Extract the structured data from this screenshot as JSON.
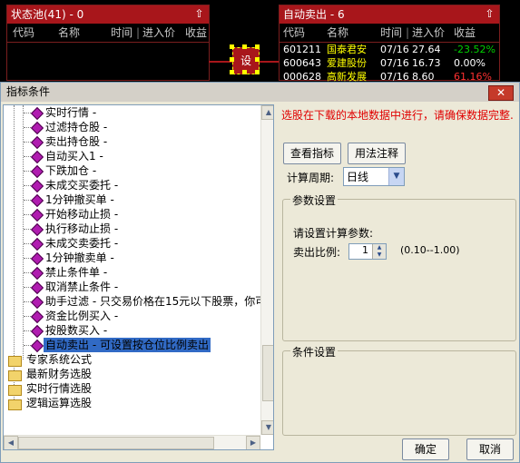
{
  "left_panel": {
    "title": "状态池(41) - 0",
    "headers": [
      "代码",
      "名称",
      "时间",
      "进入价",
      "收益"
    ]
  },
  "right_panel": {
    "title": "自动卖出 - 6",
    "headers": [
      "代码",
      "名称",
      "时间",
      "进入价",
      "收益"
    ],
    "rows": [
      {
        "code": "601211",
        "name": "国泰君安",
        "time": "07/16",
        "price": "27.64",
        "gain": "-23.52%",
        "gain_color": "#00d000"
      },
      {
        "code": "600643",
        "name": "爱建股份",
        "time": "07/16",
        "price": "16.73",
        "gain": "0.00%",
        "gain_color": "#ffffff"
      },
      {
        "code": "000628",
        "name": "高新发展",
        "time": "07/16",
        "price": "8.60",
        "gain": "61.16%",
        "gain_color": "#ff3030"
      }
    ]
  },
  "set_node": {
    "label": "设"
  },
  "dialog": {
    "title": "指标条件",
    "close": "✕",
    "tree_items": [
      "实时行情 -",
      "过滤持仓股 -",
      "卖出持仓股 -",
      "自动买入1 -",
      "下跌加仓 -",
      "未成交买委托 -",
      "1分钟撤买单 -",
      "开始移动止损 -",
      "执行移动止损 -",
      "未成交卖委托 -",
      "1分钟撤卖单 -",
      "禁止条件单 -",
      "取消禁止条件 -",
      "助手过滤 - 只交易价格在15元以下股票，你可",
      "资金比例买入 -",
      "按股数买入 -",
      "自动卖出 - 可设置按仓位比例卖出"
    ],
    "tree_folders": [
      "专家系统公式",
      "最新财务选股",
      "实时行情选股",
      "逻辑运算选股"
    ],
    "notice": "选股在下载的本地数据中进行，请确保数据完整.",
    "view_button": "查看指标",
    "usage_button": "用法注释",
    "period_label": "计算周期:",
    "period_value": "日线",
    "params_group": "参数设置",
    "params_prompt": "请设置计算参数:",
    "sell_ratio_label": "卖出比例:",
    "sell_ratio_value": "1",
    "sell_ratio_range": "(0.10--1.00)",
    "cond_group": "条件设置",
    "ok": "确定",
    "cancel": "取消"
  },
  "colors": {
    "panel_title": "#a8161b",
    "selection": "#316ac5",
    "notice": "#e00000"
  }
}
